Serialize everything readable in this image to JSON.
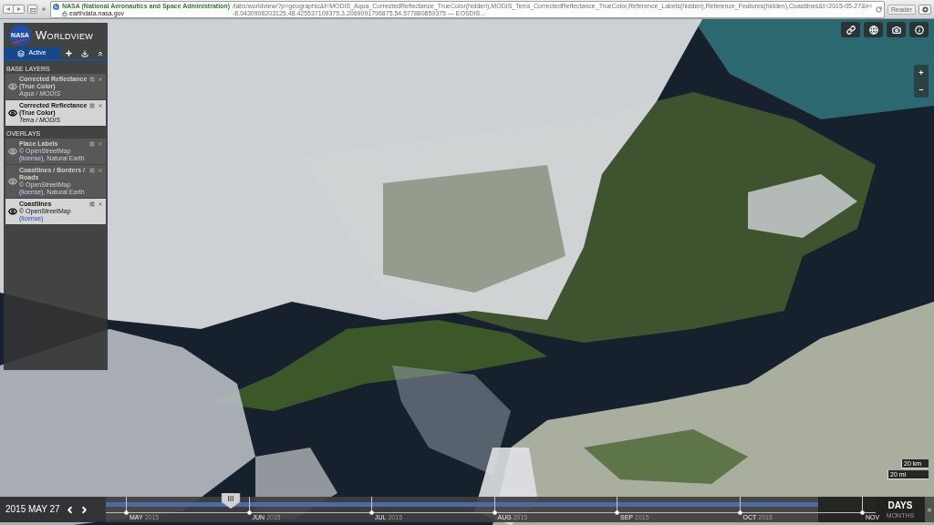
{
  "browser_bar": {
    "site_identity": "NASA (National Aeronautics and Space Administration)",
    "url_host": "earthdata.nasa.gov",
    "url_path": "/labs/worldview/?p=geographic&l=MODIS_Aqua_CorrectedReflectance_TrueColor(hidden),MODIS_Terra_CorrectedReflectance_TrueColor,Reference_Labels(hidden),Reference_Features(hidden),Coastlines&t=2015-05-27&v=-8.0430908203125,48.425537109375,3.2069091796875,54.577880859375 — EOSDIS...",
    "reader_button": "Reader"
  },
  "sidebar": {
    "logo_text": "NASA",
    "app_name": "WORLDVIEW",
    "tabs": [
      {
        "label": "Active",
        "selected": true
      }
    ],
    "sections": [
      {
        "title": "BASE LAYERS",
        "layers": [
          {
            "title": "Corrected Reflectance (True Color)",
            "subtitle": "Aqua / MODIS",
            "visible": false
          },
          {
            "title": "Corrected Reflectance (True Color)",
            "subtitle": "Terra / MODIS",
            "visible": true
          }
        ]
      },
      {
        "title": "OVERLAYS",
        "layers": [
          {
            "title": "Place Labels",
            "attribution": "© OpenStreetMap",
            "license_link": "(license)",
            "attribution_suffix": ", Natural Earth",
            "visible": false
          },
          {
            "title": "Coastlines / Borders / Roads",
            "attribution": "© OpenStreetMap",
            "license_link": "(license)",
            "attribution_suffix": ", Natural Earth",
            "visible": false
          },
          {
            "title": "Coastlines",
            "attribution": "© OpenStreetMap",
            "license_link": "(license)",
            "visible": true
          }
        ]
      }
    ]
  },
  "map_controls": {
    "zoom_in": "+",
    "zoom_out": "–"
  },
  "scale_bar": [
    "20 km",
    "20 mi"
  ],
  "timeline": {
    "date": "2015 MAY 27",
    "data_range": {
      "level": 0.925
    },
    "handle": {
      "level": 0.162
    },
    "months": [
      {
        "month": "MAY",
        "year": "2015"
      },
      {
        "month": "JUN",
        "year": "2015"
      },
      {
        "month": "JUL",
        "year": "2015"
      },
      {
        "month": "AUG",
        "year": "2015"
      },
      {
        "month": "SEP",
        "year": "2015"
      },
      {
        "month": "OCT",
        "year": "2015"
      },
      {
        "month": "NOV"
      }
    ],
    "zoom_levels": [
      {
        "label": "DAYS",
        "selected": true
      },
      {
        "label": "MONTHS",
        "selected": false
      }
    ]
  }
}
